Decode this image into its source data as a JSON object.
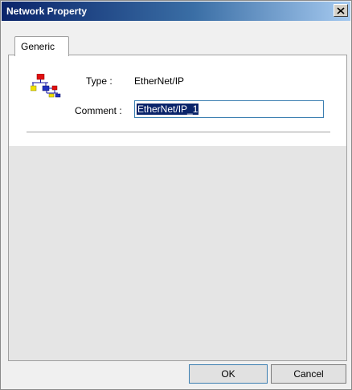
{
  "window": {
    "title": "Network Property"
  },
  "tabs": [
    {
      "label": "Generic"
    }
  ],
  "properties": {
    "type_label": "Type :",
    "type_value": "EtherNet/IP",
    "comment_label": "Comment :",
    "comment_value": "EtherNet/IP_1"
  },
  "buttons": {
    "ok": "OK",
    "cancel": "Cancel"
  },
  "icons": {
    "title_close": "close-icon",
    "network": "network-icon"
  },
  "colors": {
    "titlebar": "#0a246a",
    "selection": "#0a246a"
  }
}
